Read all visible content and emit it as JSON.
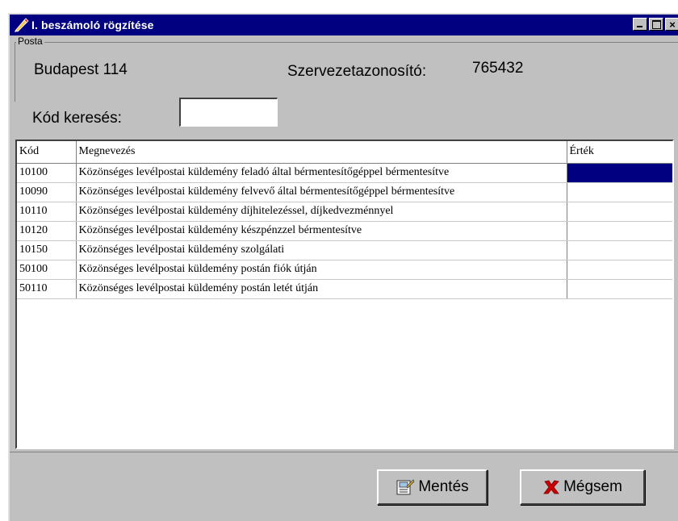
{
  "window": {
    "title": "I. beszámoló rögzítése",
    "controls": {
      "minimize": "_",
      "maximize": "□",
      "close": "×"
    }
  },
  "header": {
    "group_label": "Posta",
    "post_name": "Budapest 114",
    "org_label": "Szervezetazonosító:",
    "org_value": "765432"
  },
  "search": {
    "label": "Kód keresés:",
    "value": ""
  },
  "table": {
    "columns": [
      "Kód",
      "Megnevezés",
      "Érték"
    ],
    "rows": [
      {
        "code": "10100",
        "name": "Közönséges levélpostai küldemény feladó által bérmentesítőgéppel bérmentesítve",
        "value": ""
      },
      {
        "code": "10090",
        "name": "Közönséges levélpostai küldemény felvevő által bérmentesítőgéppel bérmentesítve",
        "value": ""
      },
      {
        "code": "10110",
        "name": "Közönséges levélpostai küldemény díjhitelezéssel, díjkedvezménnyel",
        "value": ""
      },
      {
        "code": "10120",
        "name": "Közönséges levélpostai küldemény készpénzzel bérmentesítve",
        "value": ""
      },
      {
        "code": "10150",
        "name": "Közönséges levélpostai küldemény szolgálati",
        "value": ""
      },
      {
        "code": "50100",
        "name": "Közönséges levélpostai küldemény postán fiók útján",
        "value": ""
      },
      {
        "code": "50110",
        "name": "Közönséges levélpostai küldemény postán letét útján",
        "value": ""
      }
    ],
    "selected_row": 0
  },
  "buttons": {
    "save_label": "Mentés",
    "save_icon": "save-icon",
    "cancel_label": "Mégsem",
    "cancel_icon": "red-x-icon"
  },
  "colors": {
    "titlebar": "#000080",
    "window_face": "#c0c0c0",
    "selection": "#000080",
    "cancel_x": "#cc0000"
  }
}
